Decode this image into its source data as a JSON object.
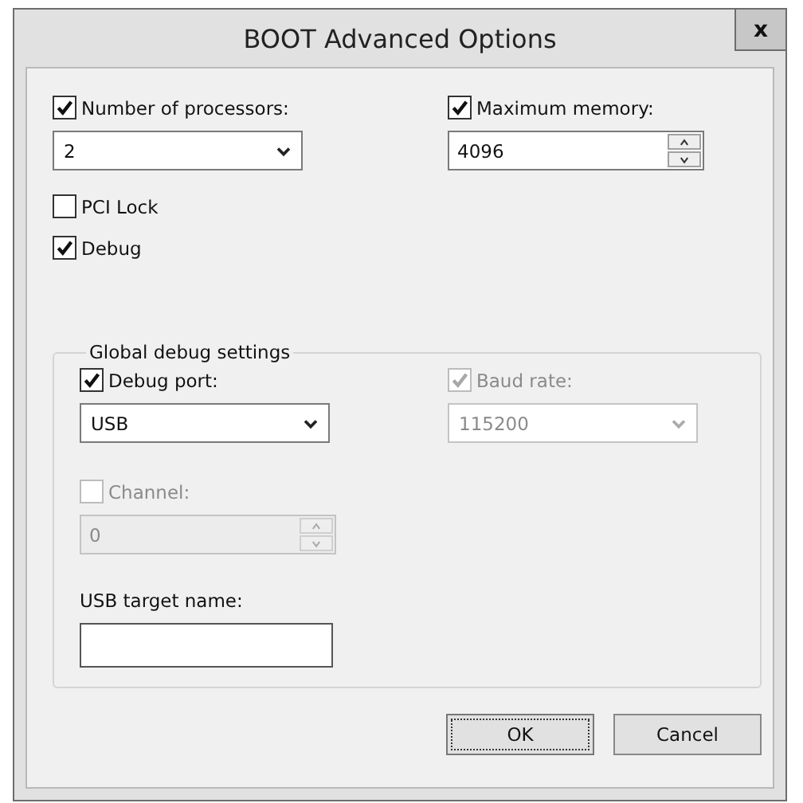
{
  "window": {
    "title": "BOOT Advanced Options",
    "close": "x"
  },
  "options": [
    {
      "kind": "dropdown",
      "label": "Number of processors:",
      "checked": true,
      "disabled": false,
      "value": "2"
    },
    {
      "kind": "spin",
      "label": "Maximum memory:",
      "checked": true,
      "disabled": false,
      "value": "4096"
    },
    {
      "kind": "check",
      "label": "PCI Lock",
      "checked": false,
      "disabled": false
    },
    {
      "kind": "check",
      "label": "Debug",
      "checked": true,
      "disabled": false
    }
  ],
  "group": {
    "title": "Global debug settings",
    "fields": [
      {
        "kind": "dropdown",
        "label": "Debug port:",
        "checked": true,
        "disabled": false,
        "value": "USB"
      },
      {
        "kind": "dropdown",
        "label": "Baud rate:",
        "checked": true,
        "disabled": true,
        "value": "115200"
      },
      {
        "kind": "spin",
        "label": "Channel:",
        "checked": false,
        "disabled": true,
        "value": "0"
      },
      {
        "kind": "text",
        "label": "USB target name:"
      }
    ]
  },
  "buttons": [
    {
      "label": "OK",
      "focused": true
    },
    {
      "label": "Cancel",
      "focused": false
    }
  ]
}
